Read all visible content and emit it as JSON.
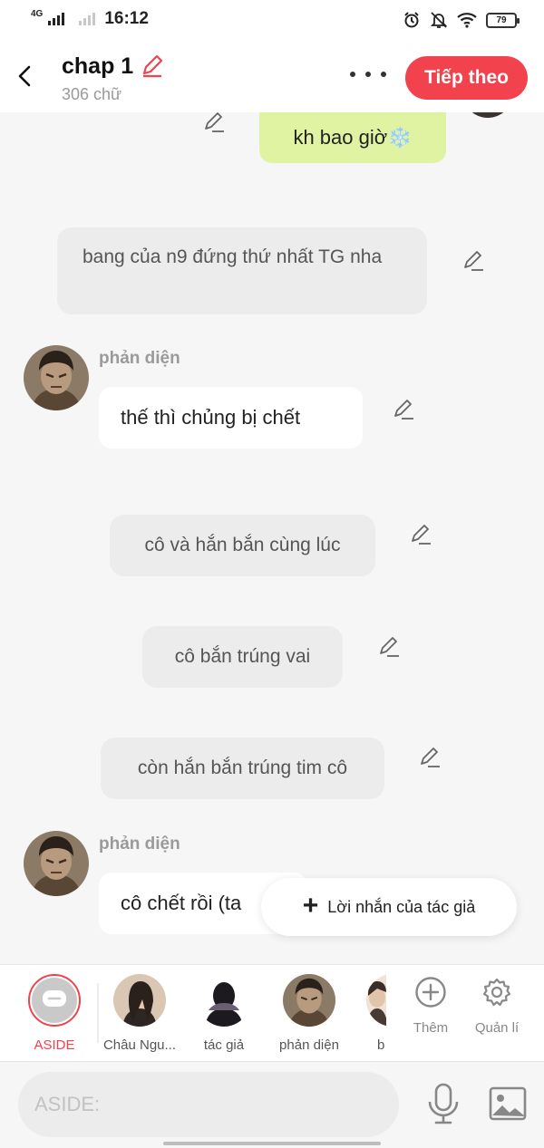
{
  "status_bar": {
    "network": "4G",
    "time": "16:12",
    "battery": "79"
  },
  "header": {
    "title": "chap 1",
    "word_count": "306 chữ",
    "next_label": "Tiếp theo"
  },
  "messages": [
    {
      "kind": "user",
      "text": "kh bao giờ❄️"
    },
    {
      "kind": "narration",
      "text": "bang của n9 đứng thứ nhất TG nha"
    },
    {
      "kind": "character",
      "speaker": "phản diện",
      "text": "thế thì chủng bị chết"
    },
    {
      "kind": "narration",
      "text": "cô và hắn bắn cùng lúc"
    },
    {
      "kind": "narration",
      "text": "cô bắn trúng vai"
    },
    {
      "kind": "narration",
      "text": "còn hắn bắn trúng tim cô"
    },
    {
      "kind": "character",
      "speaker": "phản diện",
      "text": "cô chết rồi (ta"
    }
  ],
  "author_note": "Lời nhắn của tác giả",
  "characters": [
    {
      "name": "ASIDE",
      "selected": true
    },
    {
      "name": "Châu Ngu..."
    },
    {
      "name": "tác giả"
    },
    {
      "name": "phản diện"
    },
    {
      "name": "b"
    }
  ],
  "tools": {
    "add_label": "Thêm",
    "manage_label": "Quản lí"
  },
  "input": {
    "placeholder": "ASIDE:"
  },
  "colors": {
    "accent": "#f2424e",
    "user_bubble": "#dff3a3",
    "narration_bubble": "#ececec",
    "selected_label": "#f2424e"
  }
}
